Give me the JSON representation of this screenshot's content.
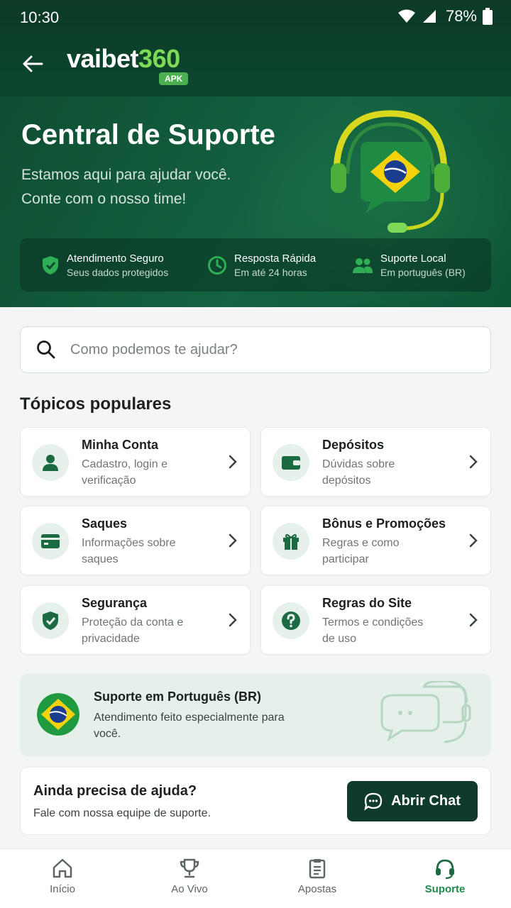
{
  "status": {
    "time": "10:30",
    "battery": "78%"
  },
  "brand": {
    "name": "vaibet",
    "number": "360",
    "tag": "APK"
  },
  "hero": {
    "title": "Central de Suporte",
    "subtitle_line1": "Estamos aqui para ajudar você.",
    "subtitle_line2": "Conte com o nosso time!"
  },
  "features": [
    {
      "title": "Atendimento Seguro",
      "sub": "Seus dados protegidos",
      "icon": "shield-check-icon"
    },
    {
      "title": "Resposta Rápida",
      "sub": "Em até 24 horas",
      "icon": "clock-icon"
    },
    {
      "title": "Suporte Local",
      "sub": "Em português (BR)",
      "icon": "people-icon"
    }
  ],
  "search": {
    "placeholder": "Como podemos te ajudar?"
  },
  "topics_title": "Tópicos populares",
  "topics": [
    {
      "title": "Minha Conta",
      "desc": "Cadastro, login e verificação",
      "icon": "user-icon"
    },
    {
      "title": "Depósitos",
      "desc": "Dúvidas sobre depósitos",
      "icon": "wallet-icon"
    },
    {
      "title": "Saques",
      "desc": "Informações sobre saques",
      "icon": "card-icon"
    },
    {
      "title": "Bônus e Promoções",
      "desc": "Regras e como participar",
      "icon": "gift-icon"
    },
    {
      "title": "Segurança",
      "desc": "Proteção da conta e privacidade",
      "icon": "shield-icon"
    },
    {
      "title": "Regras do Site",
      "desc": "Termos e condições de uso",
      "icon": "question-icon"
    }
  ],
  "br_banner": {
    "title": "Suporte em Português (BR)",
    "desc": "Atendimento feito especialmente para você."
  },
  "help": {
    "title": "Ainda precisa de ajuda?",
    "desc": "Fale com nossa equipe de suporte.",
    "button": "Abrir Chat"
  },
  "tabs": [
    {
      "label": "Início",
      "icon": "home-icon"
    },
    {
      "label": "Ao Vivo",
      "icon": "trophy-icon"
    },
    {
      "label": "Apostas",
      "icon": "clipboard-icon"
    },
    {
      "label": "Suporte",
      "icon": "headset-icon",
      "active": true
    }
  ],
  "colors": {
    "brand_dark": "#0f3b2a",
    "accent_green": "#1f8a4c",
    "accent_lime": "#7ed957"
  }
}
